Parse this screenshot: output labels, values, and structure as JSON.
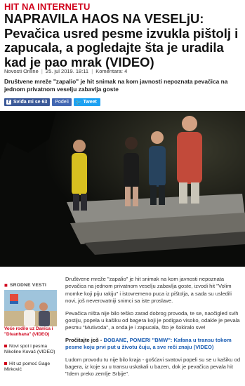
{
  "article": {
    "kicker": "HIT NA INTERNETU",
    "headline": "NAPRAVILA HAOS NA VESELjU: Pevačica usred pesme izvukla pištolj i zapucala, a pogledajte šta je uradila kad je pao mrak (VIDEO)",
    "meta": {
      "source": "Novosti Online",
      "date": "25. jul 2019. 18:11",
      "comments": "Komentara: 4",
      "separator": "|"
    },
    "lead": "Društvene mreže \"zapalio\" je hit snimak na kom javnosti nepoznata pevačica na jednom privatnom veselju zabavlja goste",
    "body": [
      "Društvene mreže \"zapalio\" je hit snimak na kom javnosti nepoznata pevačica na jednom privatnom veselju zabavlja goste, izvodi hit \"Volim momke koji piju rakiju\" i istovremeno puca iz pištolja, a sada su usledili novi, još neverovatniji snimci sa iste proslave.",
      "Pevačica ništa nije bilo teško zarad dobrog provoda, te se, naočigled svih gostiju, popela u kašiku od bagera koji je podigao visoko, odakle je pevala pesmu \"Mutivoda\", a onda je i zapucala, što je šokiralo sve!"
    ],
    "read_also": {
      "prefix": "Pročitajte još - ",
      "title": "BOBANE, POMERI \"BMW\": Kafana u transu tokom pesme koju prvi put u životu čuju, a sve reči znaju (VIDEO)"
    },
    "body_after": "Ludom provodu tu nije bilo kraja - gošćavi svatovi popeli su se u kašiku od bagera, iz koje su u transu uskakali u bazen, dok je pevačica pevala hit \"Idem preko zemlje Srbije\"."
  },
  "share": {
    "facebook_glyph": "f",
    "facebook_label": "Sviđa mi se",
    "facebook_count": "63",
    "share_label": "Podeli",
    "tweet_glyph": "🐦",
    "tweet_label": "Tweet"
  },
  "sidebar": {
    "heading_marker": "■",
    "heading": "SRODNE VESTI",
    "featured_caption": "Voće rodilo uz Danica i \"Divanhana\" (VIDEO)",
    "links": [
      "Novi spot i pesma Nikoline Kovač (VIDEO)",
      "Hit uz pomoć Gage Mirković"
    ]
  },
  "colors": {
    "accent": "#d0021b",
    "facebook": "#3b5998",
    "twitter": "#1da1f2",
    "link": "#1a5db3"
  },
  "icons": {
    "facebook": "facebook-icon",
    "twitter": "twitter-icon",
    "sidebar_marker": "square-icon"
  }
}
